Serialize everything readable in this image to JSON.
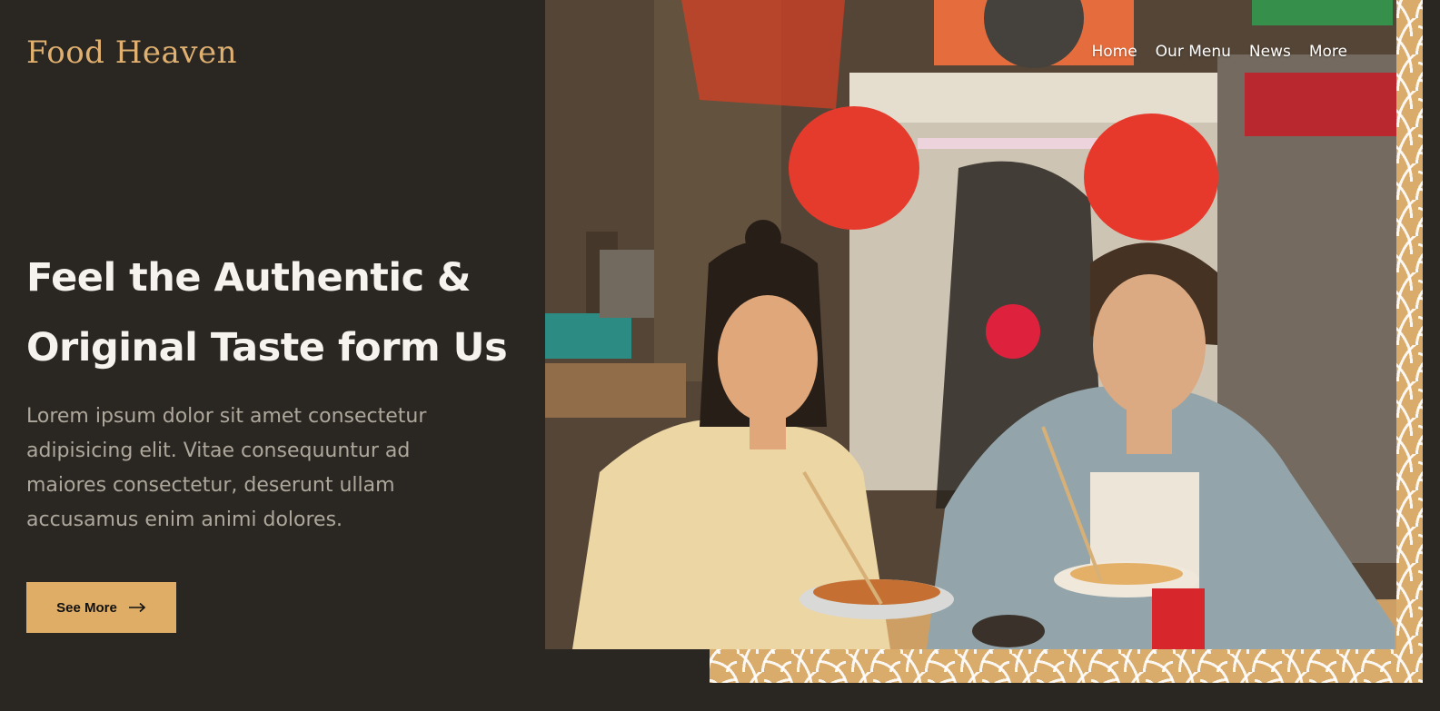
{
  "brand": {
    "name": "Food Heaven"
  },
  "nav": {
    "items": [
      "Home",
      "Our Menu",
      "News",
      "More"
    ]
  },
  "hero": {
    "title_line1": "Feel the Authentic &",
    "title_line2": "Original Taste form Us",
    "description": "Lorem ipsum dolor sit amet consectetur adipisicing elit. Vitae consequuntur ad maiores consectetur, deserunt ullam accusamus enim animi dolores.",
    "cta_label": "See More"
  },
  "colors": {
    "background": "#2a2722",
    "accent": "#dfad65",
    "logo": "#e0b070"
  },
  "icons": {
    "cta": "arrow-right-icon"
  }
}
